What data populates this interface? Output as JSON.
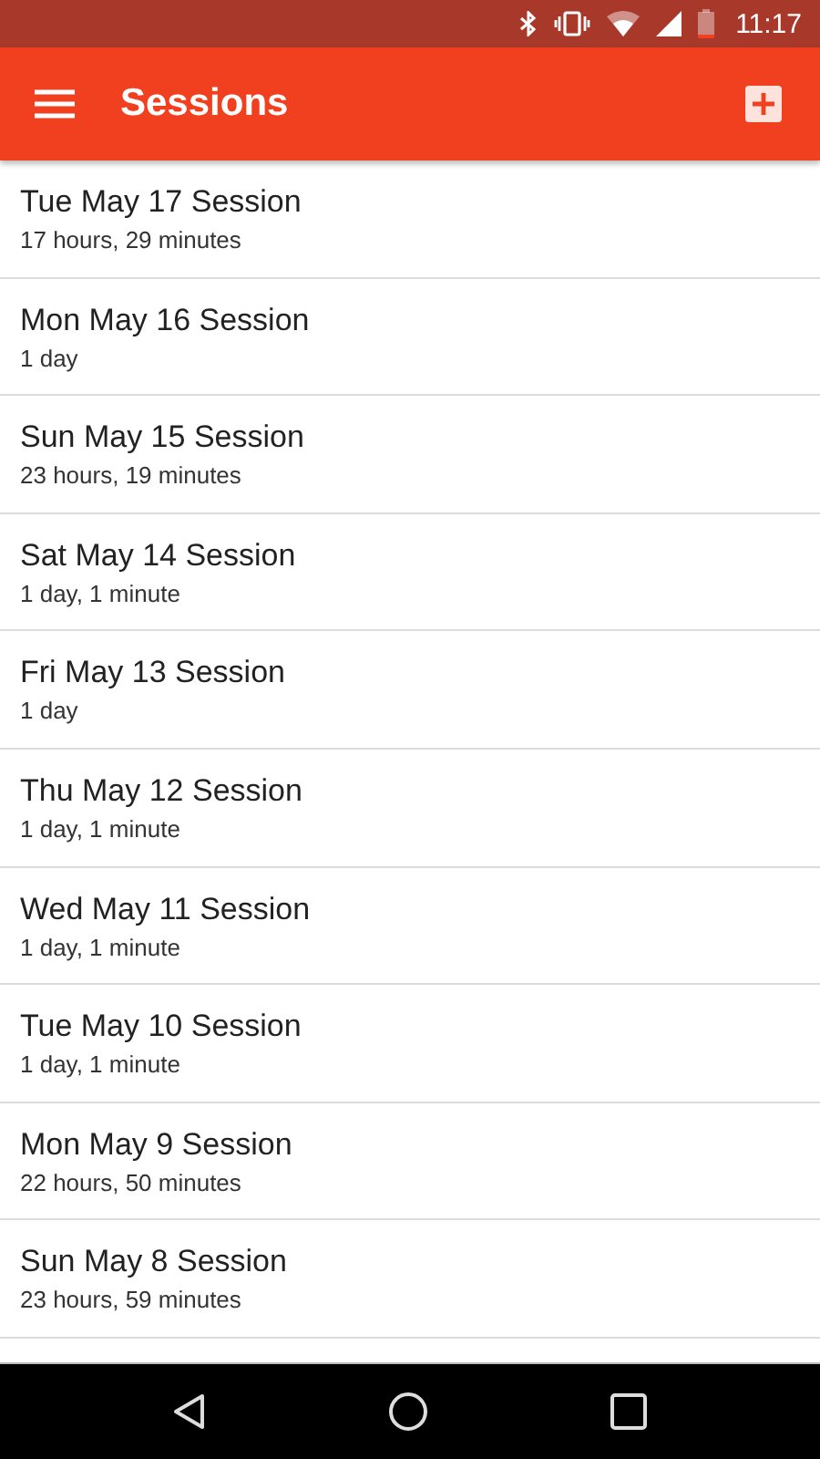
{
  "status_bar": {
    "time": "11:17"
  },
  "app_bar": {
    "title": "Sessions"
  },
  "sessions": [
    {
      "title": "Tue May 17 Session",
      "duration": "17 hours, 29 minutes"
    },
    {
      "title": "Mon May 16 Session",
      "duration": "1 day"
    },
    {
      "title": "Sun May 15 Session",
      "duration": "23 hours, 19 minutes"
    },
    {
      "title": "Sat May 14 Session",
      "duration": "1 day, 1 minute"
    },
    {
      "title": "Fri May 13 Session",
      "duration": "1 day"
    },
    {
      "title": "Thu May 12 Session",
      "duration": "1 day, 1 minute"
    },
    {
      "title": "Wed May 11 Session",
      "duration": "1 day, 1 minute"
    },
    {
      "title": "Tue May 10 Session",
      "duration": "1 day, 1 minute"
    },
    {
      "title": "Mon May 9 Session",
      "duration": "22 hours, 50 minutes"
    },
    {
      "title": "Sun May 8 Session",
      "duration": "23 hours, 59 minutes"
    }
  ]
}
